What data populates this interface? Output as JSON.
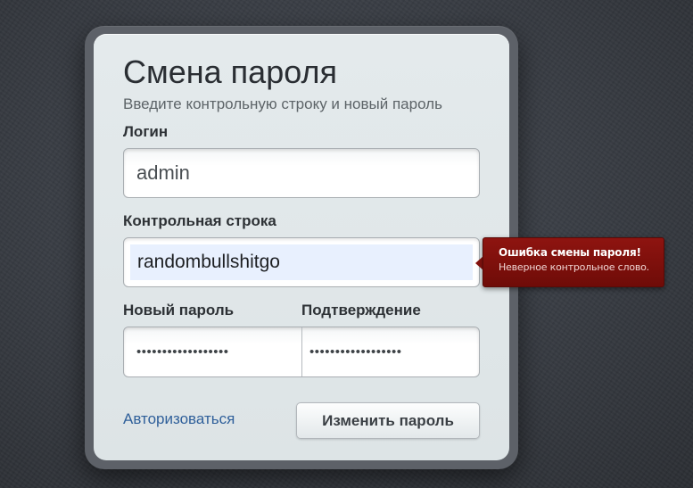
{
  "form": {
    "title": "Смена пароля",
    "subtitle": "Введите контрольную строку и новый пароль",
    "login_label": "Логин",
    "login_value": "admin",
    "control_label": "Контрольная строка",
    "control_value": "randombullshitgo",
    "new_password_label": "Новый пароль",
    "new_password_value": "••••••••••••••••••",
    "confirm_label": "Подтверждение",
    "confirm_value": "••••••••••••••••••",
    "login_link": "Авторизоваться",
    "submit_label": "Изменить пароль"
  },
  "error_tooltip": {
    "title": "Ошибка смены пароля!",
    "message": "Неверное контрольное слово."
  },
  "colors": {
    "link": "#2f5f9a",
    "error_bg": "#7f100c",
    "autofill_bg": "#e8f0fe"
  }
}
